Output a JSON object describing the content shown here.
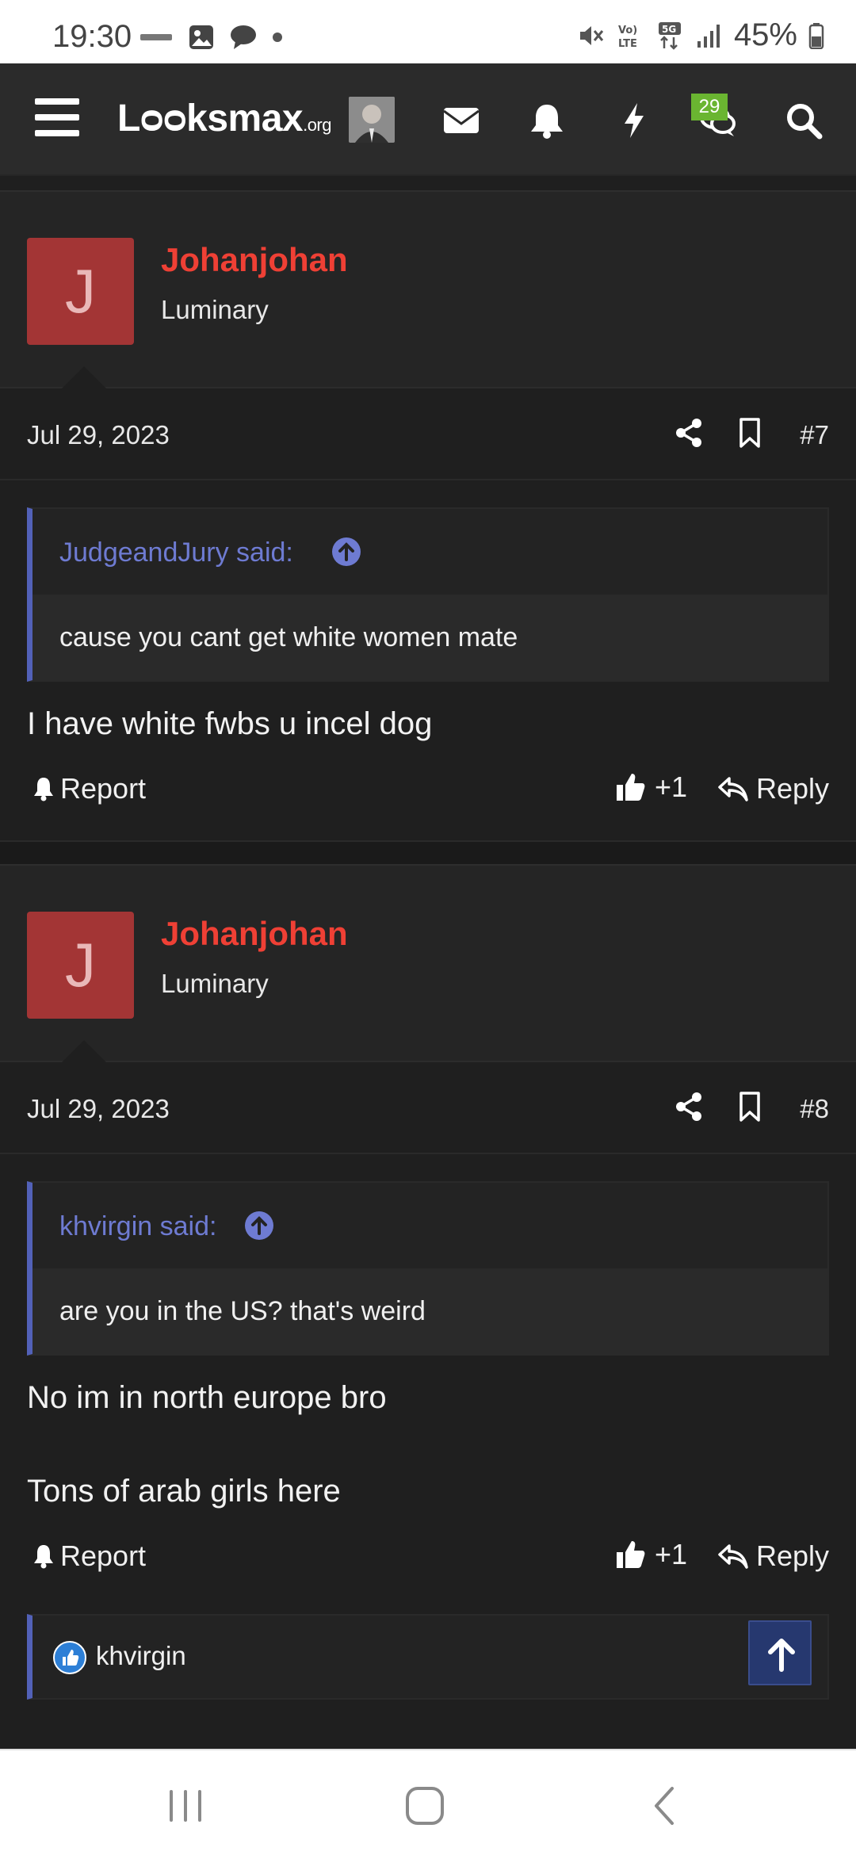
{
  "status_bar": {
    "time": "19:30",
    "battery": "45%",
    "left_icons": [
      "carrier-logo-icon",
      "gallery-icon",
      "chat-bubble-icon",
      "dot-icon"
    ],
    "right_icons": [
      "mute-icon",
      "volte-icon",
      "5g-icon",
      "signal-icon",
      "battery-icon"
    ]
  },
  "header": {
    "logo_main": "Lᴑᴑksmax",
    "logo_suffix": ".org",
    "chat_badge": "29",
    "icons": [
      "menu-icon",
      "user-avatar-icon",
      "envelope-icon",
      "bell-icon",
      "lightning-icon",
      "chat-icon",
      "search-icon"
    ]
  },
  "posts": [
    {
      "avatar_letter": "J",
      "username": "Johanjohan",
      "user_title": "Luminary",
      "date": "Jul 29, 2023",
      "post_number": "#7",
      "quote_author": "JudgeandJury said:",
      "quote_text": "cause you cant get white women mate",
      "message": [
        "I have white fwbs u incel dog"
      ],
      "report_label": "Report",
      "like_label": "+1",
      "reply_label": "Reply"
    },
    {
      "avatar_letter": "J",
      "username": "Johanjohan",
      "user_title": "Luminary",
      "date": "Jul 29, 2023",
      "post_number": "#8",
      "quote_author": "khvirgin said:",
      "quote_text": "are you in the US? that's weird",
      "message": [
        "No im in north europe bro",
        "Tons of arab girls here"
      ],
      "report_label": "Report",
      "like_label": "+1",
      "reply_label": "Reply",
      "reaction_user": "khvirgin"
    }
  ],
  "colors": {
    "username": "#ef4035",
    "quote_accent": "#5261b8",
    "avatar_bg": "#a33535",
    "badge": "#6ab531",
    "page_bg": "#1f1f1f"
  },
  "navbar": {
    "icons": [
      "recent-apps-icon",
      "home-icon",
      "back-icon"
    ]
  }
}
